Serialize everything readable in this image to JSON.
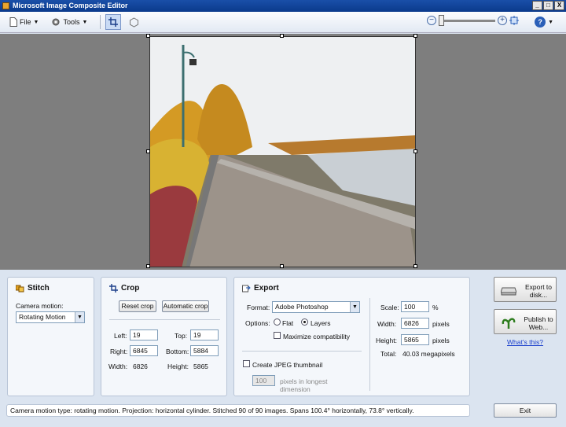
{
  "window": {
    "title": "Microsoft Image Composite Editor",
    "buttons": [
      "_",
      "□",
      "X"
    ]
  },
  "toolbar": {
    "file_label": "File",
    "tools_label": "Tools",
    "zoom_out": "−",
    "zoom_in": "+",
    "help": "?"
  },
  "stitch": {
    "title": "Stitch",
    "camera_motion_label": "Camera motion:",
    "camera_motion_value": "Rotating Motion"
  },
  "crop": {
    "title": "Crop",
    "reset_label": "Reset crop",
    "auto_label": "Automatic crop",
    "left_label": "Left:",
    "left_value": "19",
    "top_label": "Top:",
    "top_value": "19",
    "right_label": "Right:",
    "right_value": "6845",
    "bottom_label": "Bottom:",
    "bottom_value": "5884",
    "width_label": "Width:",
    "width_value": "6826",
    "height_label": "Height:",
    "height_value": "5865"
  },
  "export": {
    "title": "Export",
    "format_label": "Format:",
    "format_value": "Adobe Photoshop",
    "options_label": "Options:",
    "flat_label": "Flat",
    "layers_label": "Layers",
    "maximize_label": "Maximize compatibility",
    "jpeg_label": "Create JPEG thumbnail",
    "thumb_value": "100",
    "thumb_suffix": "pixels in longest dimension",
    "scale_label": "Scale:",
    "scale_value": "100",
    "scale_unit": "%",
    "width_label": "Width:",
    "width_value": "6826",
    "width_unit": "pixels",
    "height_label": "Height:",
    "height_value": "5865",
    "height_unit": "pixels",
    "total_label": "Total:",
    "total_value": "40.03 megapixels"
  },
  "actions": {
    "export_disk": "Export to disk...",
    "publish_web": "Publish to Web...",
    "whats_this": "What's this?",
    "exit": "Exit"
  },
  "status": "Camera motion type: rotating motion. Projection: horizontal cylinder. Stitched 90 of 90 images. Spans 100.4° horizontally, 73.8° vertically.",
  "colors": {
    "title_bar": "#0b3a8c",
    "canvas": "#7e7e7e",
    "panel": "#f4f7fb",
    "link": "#1a3fcc"
  }
}
